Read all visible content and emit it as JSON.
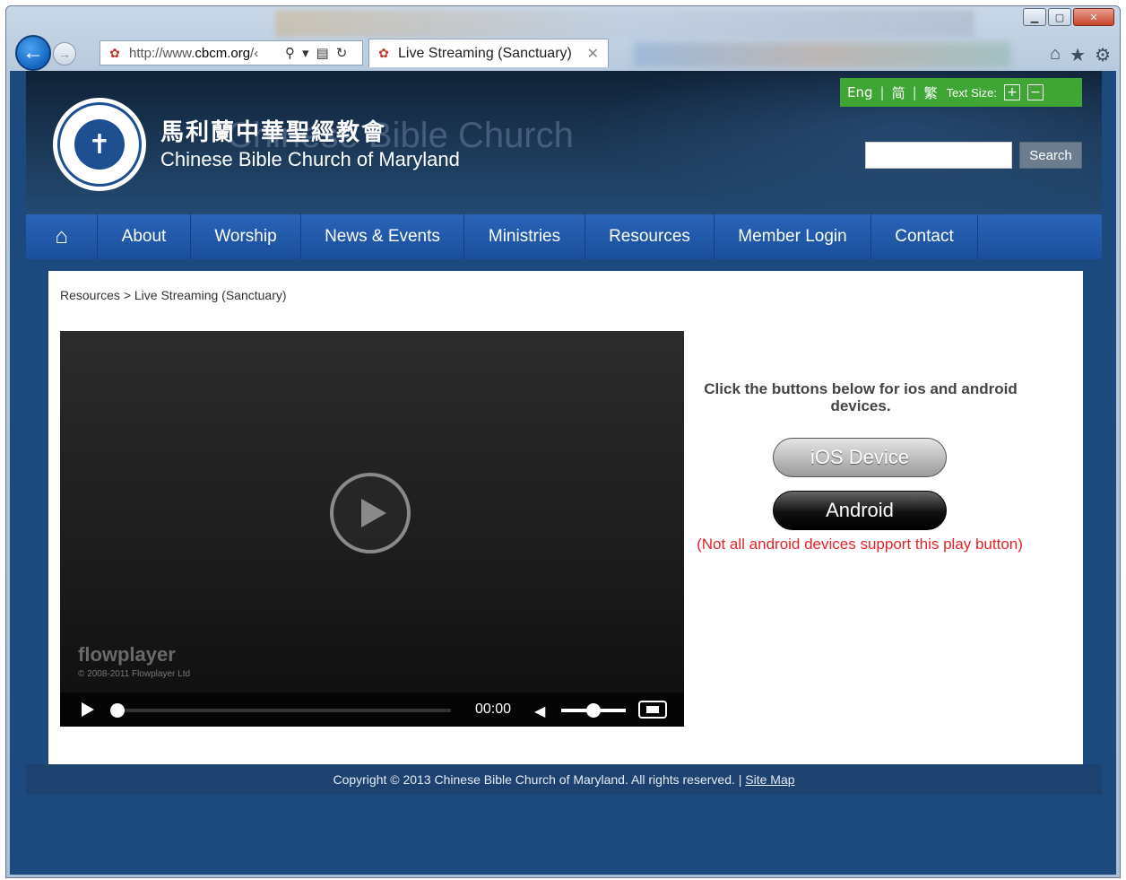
{
  "browser": {
    "address_scheme": "http://www.",
    "address_domain": "cbcm.org",
    "address_rest": "/‹",
    "tab_title": "Live Streaming (Sanctuary)",
    "icons": [
      "back-arrow-icon",
      "forward-arrow-icon",
      "search-icon",
      "compat-view-icon",
      "refresh-icon",
      "close-icon",
      "home-icon",
      "star-icon",
      "gear-icon"
    ]
  },
  "site": {
    "title_cn": "馬利蘭中華聖經教會",
    "title_en": "Chinese Bible Church of Maryland",
    "watermark": "Chinese Bible Church"
  },
  "lang": {
    "eng": "Eng",
    "simplified": "简",
    "traditional": "繁",
    "text_size_label": "Text Size:",
    "increase": "+",
    "decrease": "−"
  },
  "search": {
    "button": "Search",
    "placeholder": ""
  },
  "nav": {
    "items": [
      {
        "label": "About"
      },
      {
        "label": "Worship"
      },
      {
        "label": "News & Events"
      },
      {
        "label": "Ministries"
      },
      {
        "label": "Resources"
      },
      {
        "label": "Member Login"
      },
      {
        "label": "Contact"
      }
    ]
  },
  "breadcrumb": {
    "parent": "Resources",
    "separator": ">",
    "current": "Live Streaming (Sanctuary)"
  },
  "player": {
    "brand": "flowplayer",
    "copyright": "© 2008-2011 Flowplayer Ltd",
    "time": "00:00"
  },
  "side": {
    "instructions": "Click the buttons below for ios and android devices.",
    "ios_button": "iOS Device",
    "android_button": "Android",
    "android_note": "(Not all android devices support this play button)"
  },
  "footer": {
    "copyright": "Copyright © 2013 Chinese Bible Church of Maryland. All rights reserved. |",
    "sitemap": "Site Map"
  },
  "colors": {
    "page_bg": "#1c4a7e",
    "lang_bar": "#3fa535",
    "nav": "#2a63b8",
    "note_red": "#e3242b"
  }
}
